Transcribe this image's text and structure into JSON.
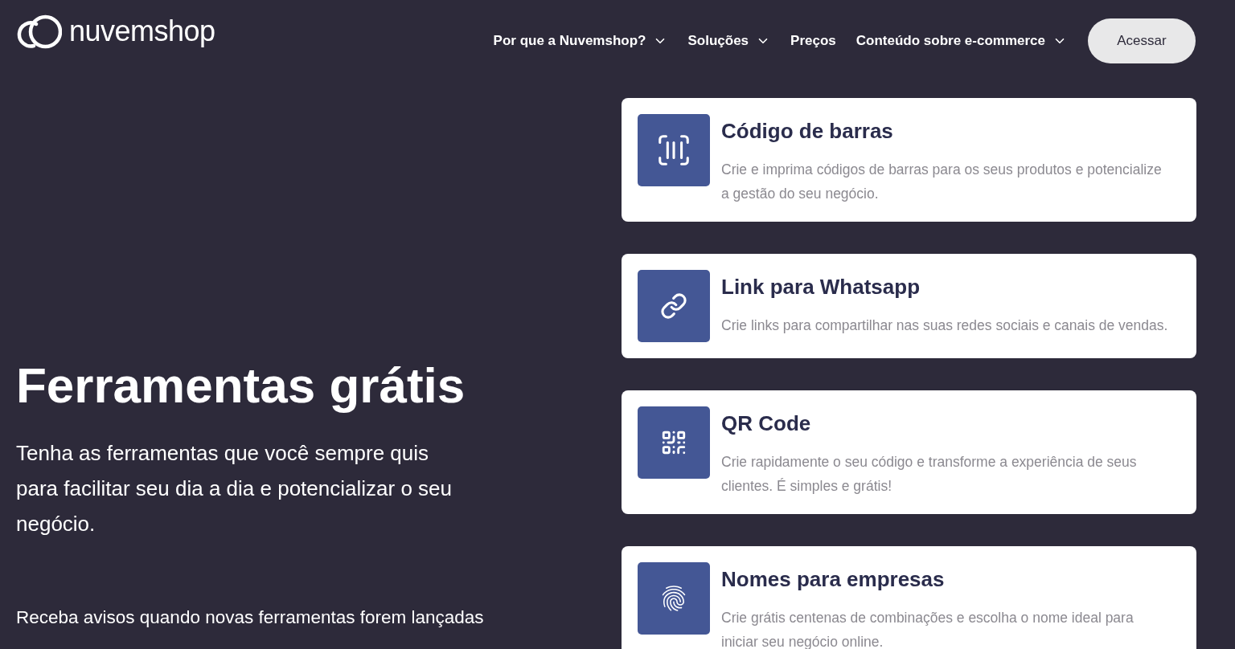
{
  "header": {
    "logo": "nuvemshop",
    "nav": [
      {
        "label": "Por que a Nuvemshop?",
        "has_menu": true
      },
      {
        "label": "Soluções",
        "has_menu": true
      },
      {
        "label": "Preços",
        "has_menu": false
      },
      {
        "label": "Conteúdo sobre e-commerce",
        "has_menu": true
      }
    ],
    "login_button": "Acessar"
  },
  "hero": {
    "title": "Ferramentas grátis",
    "subtitle": "Tenha as ferramentas que você sempre quis para facilitar seu dia a dia e potencializar o seu negócio.",
    "notice": "Receba avisos quando novas ferramentas forem lançadas"
  },
  "tools": [
    {
      "kind": "barcode",
      "title": "Código de barras",
      "description": "Crie e imprima códigos de barras para os seus produtos e potencialize a gestão do seu negócio."
    },
    {
      "kind": "link",
      "title": "Link para Whatsapp",
      "description": "Crie links para compartilhar nas suas redes sociais e canais de vendas."
    },
    {
      "kind": "qr",
      "title": "QR Code",
      "description": "Crie rapidamente o seu código e transforme a experiência de seus clientes. É simples e grátis!"
    },
    {
      "kind": "names",
      "title": "Nomes para empresas",
      "description": "Crie grátis centenas de combinações e escolha o nome ideal para iniciar seu negócio online."
    }
  ]
}
